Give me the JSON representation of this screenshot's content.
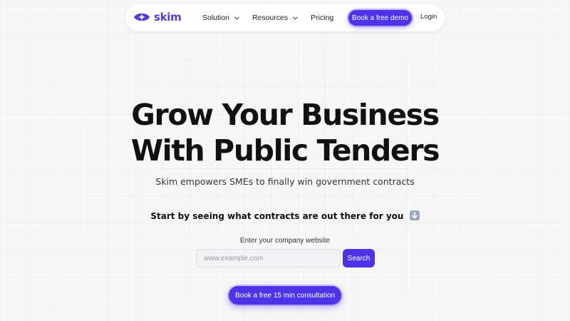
{
  "brand": {
    "name": "skim",
    "color": "#4f3ed6",
    "icon": "sparkle-eye-logo"
  },
  "nav": {
    "items": [
      {
        "label": "Solution",
        "has_dropdown": true
      },
      {
        "label": "Resources",
        "has_dropdown": true
      },
      {
        "label": "Pricing",
        "has_dropdown": false
      }
    ],
    "demo_label": "Book a free demo",
    "login_label": "Login"
  },
  "hero": {
    "title_line1": "Grow Your Business",
    "title_line2": "With Public Tenders",
    "subtitle": "Skim empowers SMEs to finally win government contracts"
  },
  "cta": {
    "text": "Start by seeing what contracts are out there for you",
    "emoji_icon": "down-arrow-emoji"
  },
  "search": {
    "label": "Enter your company website",
    "placeholder": "www.example.com",
    "value": "",
    "button_label": "Search"
  },
  "consult": {
    "label": "Book a free 15 min consultation"
  },
  "colors": {
    "accent": "#4d33e8",
    "background": "#f7f7f8"
  }
}
